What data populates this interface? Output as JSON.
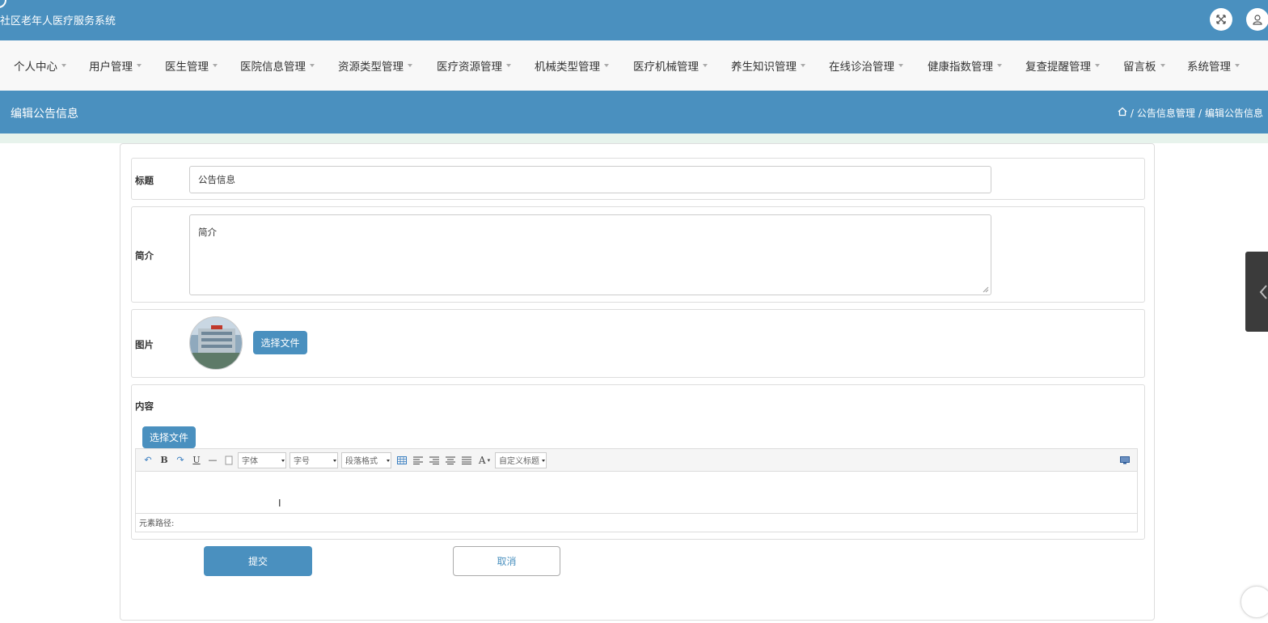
{
  "app": {
    "title": "社区老年人医疗服务系统"
  },
  "nav": {
    "items": [
      {
        "label": "个人中心"
      },
      {
        "label": "用户管理"
      },
      {
        "label": "医生管理"
      },
      {
        "label": "医院信息管理"
      },
      {
        "label": "资源类型管理"
      },
      {
        "label": "医疗资源管理"
      },
      {
        "label": "机械类型管理"
      },
      {
        "label": "医疗机械管理"
      },
      {
        "label": "养生知识管理"
      },
      {
        "label": "在线诊治管理"
      },
      {
        "label": "健康指数管理"
      },
      {
        "label": "复查提醒管理"
      },
      {
        "label": "留言板"
      },
      {
        "label": "系统管理"
      }
    ]
  },
  "page": {
    "title": "编辑公告信息",
    "breadcrumb": [
      "公告信息管理",
      "编辑公告信息"
    ]
  },
  "form": {
    "title_label": "标题",
    "title_value": "公告信息",
    "intro_label": "简介",
    "intro_value": "简介",
    "image_label": "图片",
    "image_button": "选择文件",
    "content_label": "内容",
    "content_button": "选择文件",
    "submit": "提交",
    "cancel": "取消"
  },
  "editor": {
    "font_select": "字体",
    "size_select": "字号",
    "format_select": "段落格式",
    "custom_select": "自定义标题",
    "color_glyph": "A",
    "status_path": "元素路径:"
  },
  "colors": {
    "primary": "#4a90bf",
    "nav_bg": "#f8f8f8",
    "stripe": "#e7f3ec"
  }
}
